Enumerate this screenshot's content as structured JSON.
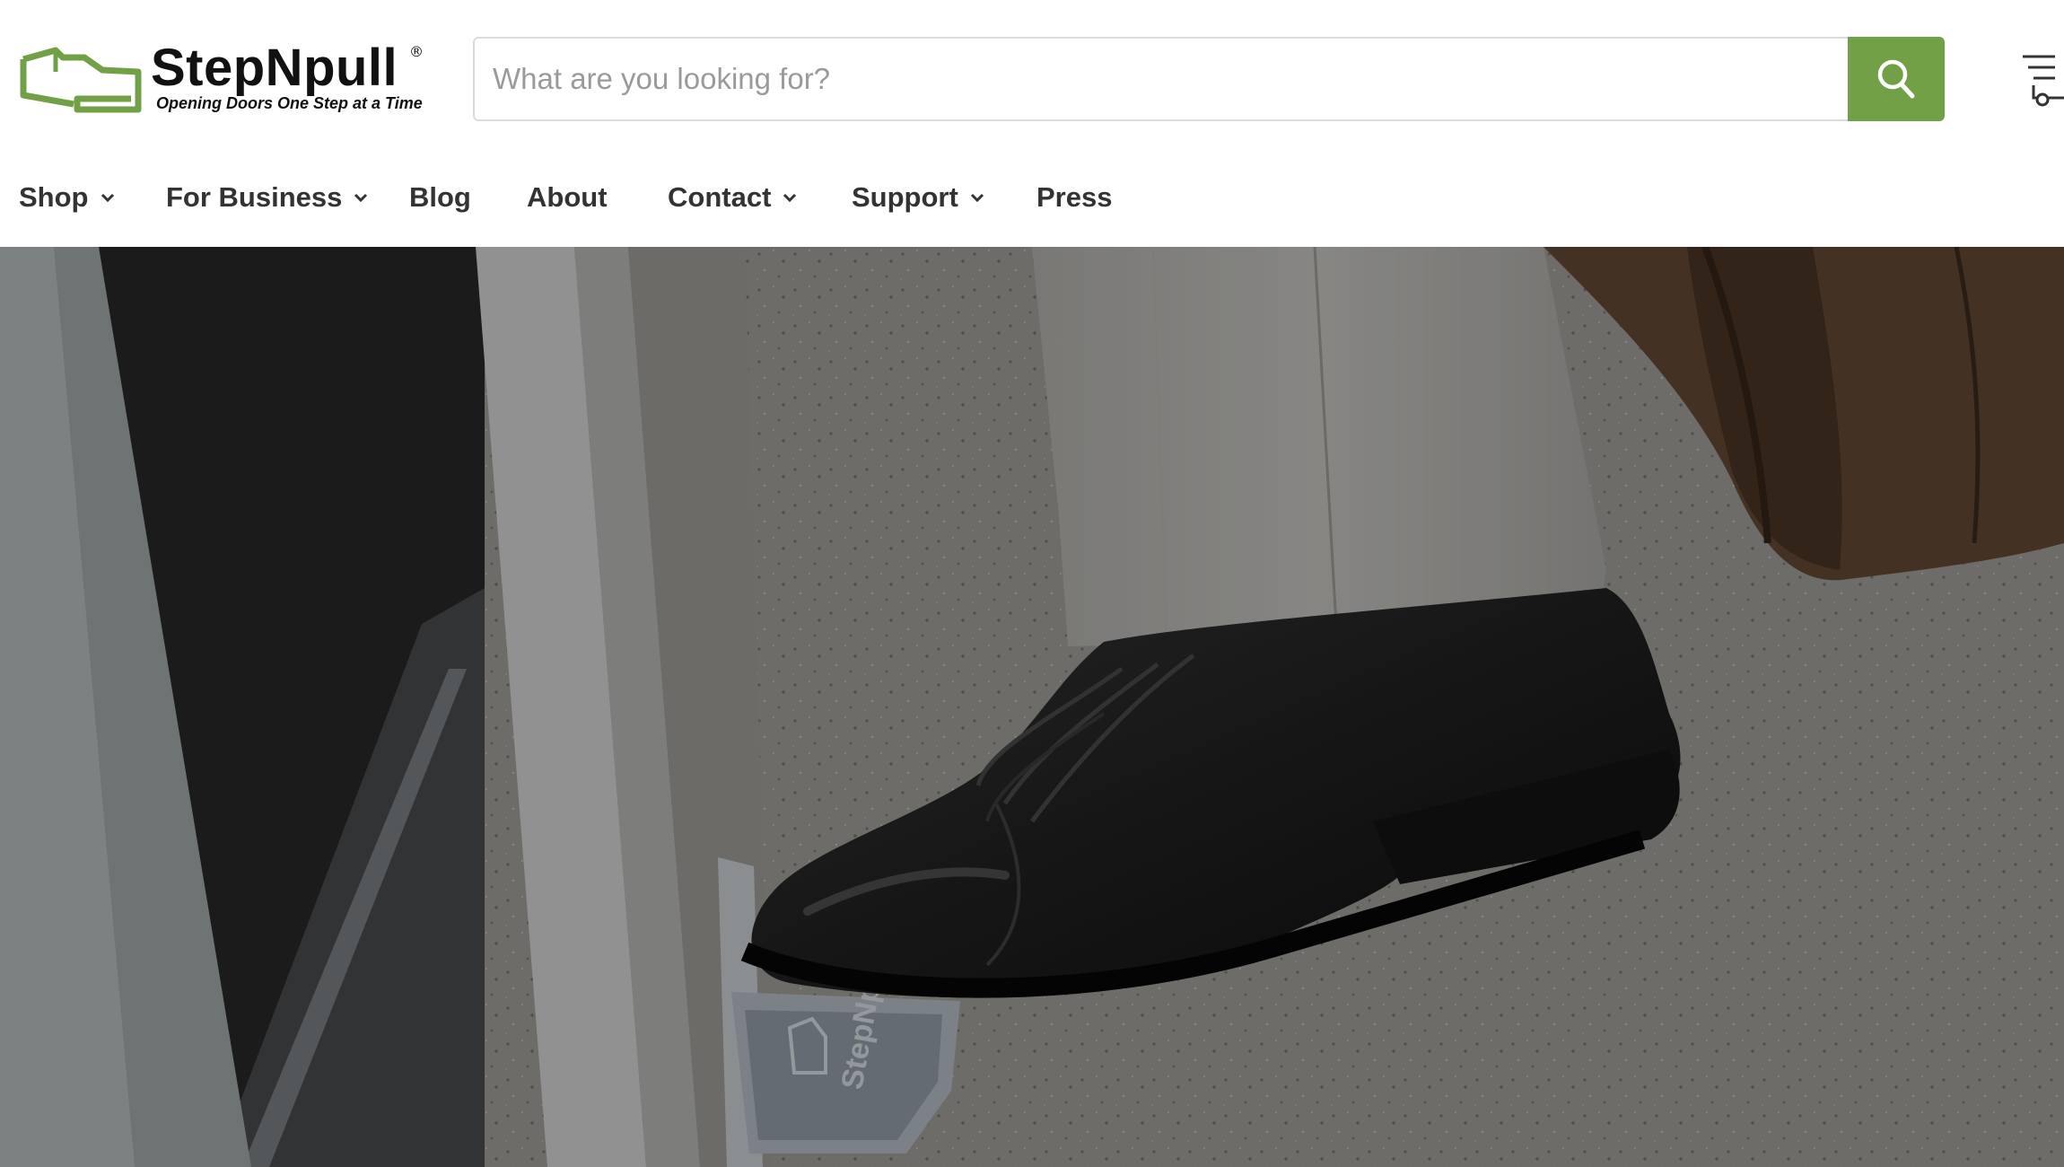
{
  "header": {
    "logo": {
      "brand": "StepNpull",
      "registered_mark": "®",
      "tagline": "Opening Doors One Step at a Time",
      "icon": "door-pull-logo-icon",
      "accent_color": "#72a047"
    },
    "search": {
      "placeholder": "What are you looking for?",
      "value": "",
      "button_icon": "search-icon",
      "button_color": "#72a047"
    },
    "cart_icon": "cart-icon"
  },
  "nav": {
    "items": [
      {
        "label": "Shop",
        "has_dropdown": true
      },
      {
        "label": "For Business",
        "has_dropdown": true
      },
      {
        "label": "Blog",
        "has_dropdown": false
      },
      {
        "label": "About",
        "has_dropdown": false
      },
      {
        "label": "Contact",
        "has_dropdown": true
      },
      {
        "label": "Support",
        "has_dropdown": true
      },
      {
        "label": "Press",
        "has_dropdown": false
      }
    ]
  },
  "hero": {
    "image": "foot-opening-door-with-stepnpull-photo",
    "product_marking": "StepNpull"
  }
}
